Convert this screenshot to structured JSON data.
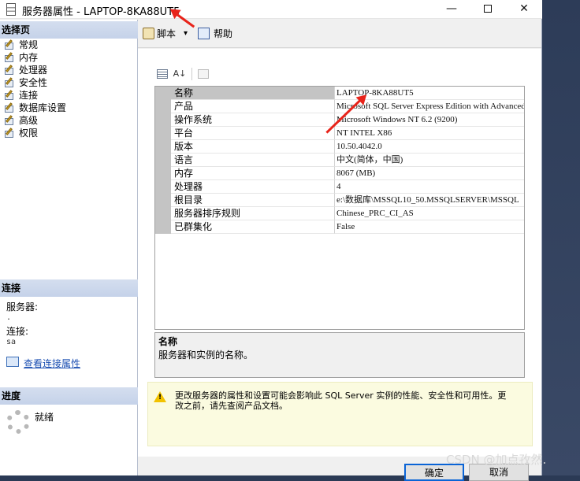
{
  "window": {
    "title": "服务器属性 - LAPTOP-8KA88UT5",
    "min": "—",
    "close": "✕"
  },
  "left": {
    "pages_head": "选择页",
    "pages": [
      "常规",
      "内存",
      "处理器",
      "安全性",
      "连接",
      "数据库设置",
      "高级",
      "权限"
    ],
    "conn_head": "连接",
    "server_label": "服务器:",
    "server_value": ".",
    "conn_label": "连接:",
    "conn_value": "sa",
    "conn_link": "查看连接属性",
    "progress_head": "进度",
    "progress_status": "就绪"
  },
  "toolbar": {
    "script": "脚本",
    "dropdown": "▾",
    "help": "帮助"
  },
  "grid": {
    "rows": [
      {
        "k": "名称",
        "v": "LAPTOP-8KA88UT5"
      },
      {
        "k": "产品",
        "v": "Microsoft SQL Server Express Edition with Advanced Services"
      },
      {
        "k": "操作系统",
        "v": "Microsoft Windows NT 6.2 (9200)"
      },
      {
        "k": "平台",
        "v": "NT INTEL X86"
      },
      {
        "k": "版本",
        "v": "10.50.4042.0"
      },
      {
        "k": "语言",
        "v": "中文(简体，中国)"
      },
      {
        "k": "内存",
        "v": "8067 (MB)"
      },
      {
        "k": "处理器",
        "v": "4"
      },
      {
        "k": "根目录",
        "v": "e:\\数据库\\MSSQL10_50.MSSQLSERVER\\MSSQL"
      },
      {
        "k": "服务器排序规则",
        "v": "Chinese_PRC_CI_AS"
      },
      {
        "k": "已群集化",
        "v": "False"
      }
    ]
  },
  "desc": {
    "title": "名称",
    "text": "服务器和实例的名称。"
  },
  "warning": {
    "text": "更改服务器的属性和设置可能会影响此 SQL Server 实例的性能、安全性和可用性。更改之前，请先查阅产品文档。"
  },
  "buttons": {
    "ok": "确定",
    "cancel": "取消"
  },
  "watermark": "CSDN @加点孜然.",
  "colors": {
    "annotation_arrow": "#e8231a",
    "section_header": "#c5d2e9",
    "warning_bg": "#fbfbe0"
  }
}
